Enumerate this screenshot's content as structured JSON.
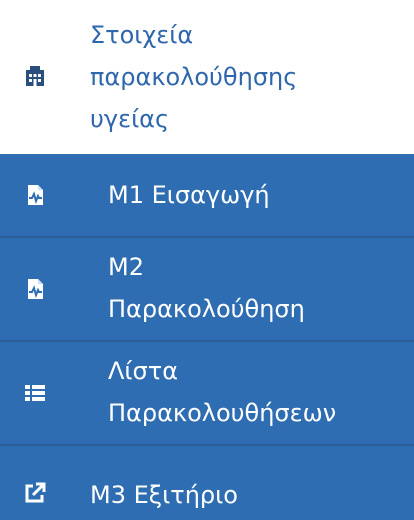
{
  "header": {
    "title": "Στοιχεία\nπαρακολούθησης\nυγείας",
    "icon": "hospital-building-icon"
  },
  "menu": {
    "items": [
      {
        "label": "Μ1 Εισαγωγή",
        "icon": "medical-file-icon"
      },
      {
        "label": "Μ2\nΠαρακολούθηση",
        "icon": "medical-file-icon"
      },
      {
        "label": "Λίστα\nΠαρακολουθήσεων",
        "icon": "list-icon"
      },
      {
        "label": "Μ3 Εξιτήριο",
        "icon": "external-link-icon"
      }
    ]
  },
  "colors": {
    "header_text": "#2f67ad",
    "menu_bg": "#2e6db2",
    "divider": "#2a5f99",
    "menu_text": "#ffffff"
  }
}
